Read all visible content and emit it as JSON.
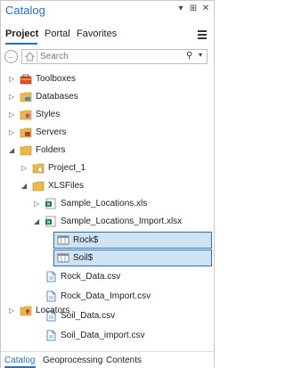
{
  "window": {
    "title": "Catalog",
    "buttons": [
      "▾",
      "⊞",
      "✕"
    ]
  },
  "tabs": [
    {
      "label": "Project",
      "active": true
    },
    {
      "label": "Portal",
      "active": false
    },
    {
      "label": "Favorites",
      "active": false
    }
  ],
  "search": {
    "placeholder": "Search"
  },
  "tree": [
    {
      "label": "Toolboxes",
      "icon": "toolbox-icon",
      "level": 0,
      "caret": "right"
    },
    {
      "label": "Databases",
      "icon": "database-icon",
      "level": 0,
      "caret": "right"
    },
    {
      "label": "Styles",
      "icon": "styles-icon",
      "level": 0,
      "caret": "right"
    },
    {
      "label": "Servers",
      "icon": "server-icon",
      "level": 0,
      "caret": "right"
    },
    {
      "label": "Folders",
      "icon": "folder-icon",
      "level": 0,
      "caret": "down"
    },
    {
      "label": "Project_1",
      "icon": "home-folder-icon",
      "level": 1,
      "caret": "right"
    },
    {
      "label": "XLSFiles",
      "icon": "folder-icon",
      "level": 1,
      "caret": "down"
    },
    {
      "label": "Sample_Locations.xls",
      "icon": "excel-icon",
      "level": 2,
      "caret": "right"
    },
    {
      "label": "Sample_Locations_Import.xlsx",
      "icon": "excel-icon",
      "level": 2,
      "caret": "down"
    },
    {
      "label": "Rock$",
      "icon": "table-icon",
      "level": 3,
      "caret": "",
      "selected": true
    },
    {
      "label": "Soil$",
      "icon": "table-icon",
      "level": 3,
      "caret": "",
      "selected": true
    },
    {
      "label": "Rock_Data.csv",
      "icon": "csv-file-icon",
      "level": 2,
      "caret": ""
    },
    {
      "label": "Rock_Data_Import.csv",
      "icon": "csv-file-icon",
      "level": 2,
      "caret": ""
    },
    {
      "label": "Soil_Data.csv",
      "icon": "csv-file-icon",
      "level": 2,
      "caret": ""
    },
    {
      "label": "Soil_Data_import.csv",
      "icon": "csv-file-icon",
      "level": 2,
      "caret": ""
    },
    {
      "label": "Locators",
      "icon": "locator-icon",
      "level": 0,
      "caret": "right"
    }
  ],
  "bottom_tabs": [
    {
      "label": "Catalog",
      "active": true
    },
    {
      "label": "Geoprocessing",
      "active": false
    },
    {
      "label": "Contents",
      "active": false
    }
  ],
  "colors": {
    "accent": "#2a70b8",
    "selection": "#cfe3f5",
    "folder": "#e9b949"
  }
}
